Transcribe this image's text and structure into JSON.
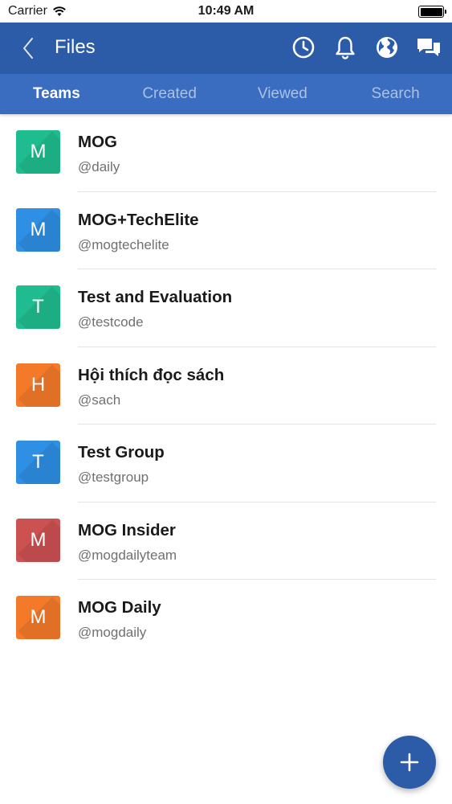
{
  "status_bar": {
    "carrier": "Carrier",
    "time": "10:49 AM"
  },
  "nav": {
    "title": "Files",
    "icons": [
      "back-chevron-icon",
      "clock-icon",
      "bell-icon",
      "globe-icon",
      "chat-icon"
    ]
  },
  "tabs": [
    {
      "label": "Teams",
      "active": true
    },
    {
      "label": "Created",
      "active": false
    },
    {
      "label": "Viewed",
      "active": false
    },
    {
      "label": "Search",
      "active": false
    }
  ],
  "teams": [
    {
      "initial": "M",
      "name": "MOG",
      "handle": "@daily",
      "color": "#1fbc8f"
    },
    {
      "initial": "M",
      "name": "MOG+TechElite",
      "handle": "@mogtechelite",
      "color": "#2e8fe3"
    },
    {
      "initial": "T",
      "name": "Test and Evaluation",
      "handle": "@testcode",
      "color": "#1fbc8f"
    },
    {
      "initial": "H",
      "name": "Hội thích đọc sách",
      "handle": "@sach",
      "color": "#f47a2a"
    },
    {
      "initial": "T",
      "name": "Test Group",
      "handle": "@testgroup",
      "color": "#2e8fe3"
    },
    {
      "initial": "M",
      "name": "MOG Insider",
      "handle": "@mogdailyteam",
      "color": "#cc5151"
    },
    {
      "initial": "M",
      "name": "MOG Daily",
      "handle": "@mogdaily",
      "color": "#f47a2a"
    }
  ],
  "fab": {
    "icon": "plus-icon",
    "color": "#2c5ba8"
  },
  "colors": {
    "nav_bg": "#2c5ba8",
    "tab_bg": "#3a6dbf",
    "tab_inactive": "#a9c2e8"
  }
}
